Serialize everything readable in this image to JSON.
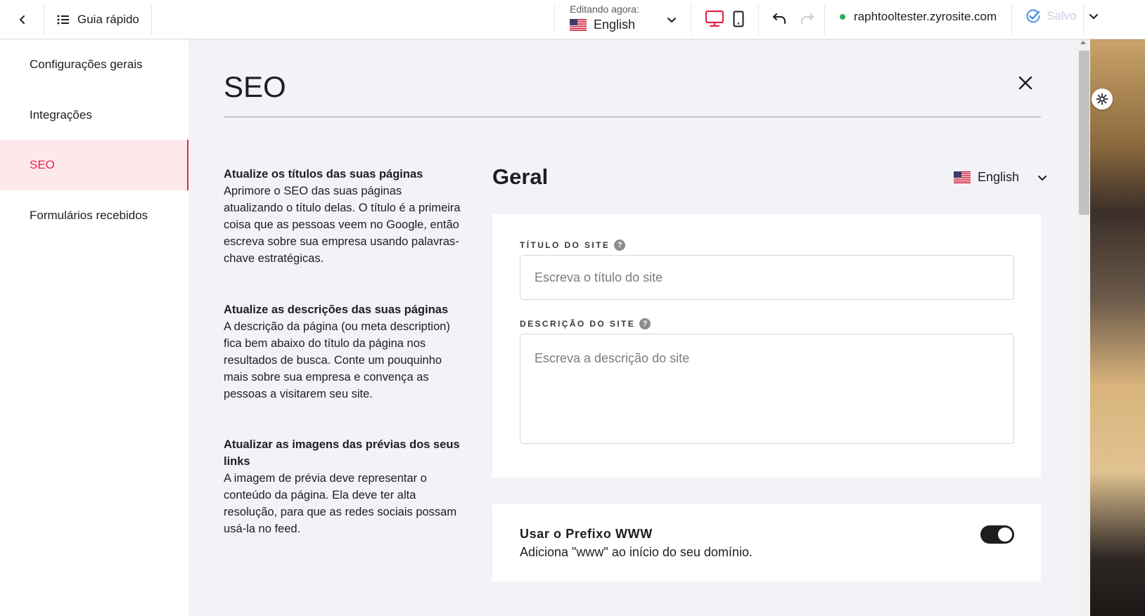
{
  "topbar": {
    "guide_label": "Guia rápido",
    "editing_caption": "Editando agora:",
    "editing_language": "English",
    "site_url": "raphtooltester.zyrosite.com",
    "saved_label": "Salvo"
  },
  "sidebar": {
    "items": [
      {
        "label": "Configurações gerais"
      },
      {
        "label": "Integrações"
      },
      {
        "label": "SEO"
      },
      {
        "label": "Formulários recebidos"
      }
    ],
    "active_index": 2
  },
  "main": {
    "title": "SEO",
    "tips": [
      {
        "title": "Atualize os títulos das suas páginas",
        "body": "Aprimore o SEO das suas páginas atualizando o título delas. O título é a primeira coisa que as pessoas veem no Google, então escreva sobre sua empresa usando palavras-chave estratégicas."
      },
      {
        "title": "Atualize as descrições das suas páginas",
        "body": "A descrição da página (ou meta description) fica bem abaixo do título da página nos resultados de busca. Conte um pouquinho mais sobre sua empresa e convença as pessoas a visitarem seu site."
      },
      {
        "title": "Atualizar as imagens das prévias dos seus links",
        "body": "A imagem de prévia deve representar o conteúdo da página. Ela deve ter alta resolução, para que as redes sociais possam usá-la no feed."
      }
    ],
    "section_title": "Geral",
    "section_language": "English",
    "site_title_label": "Título do site",
    "site_title_placeholder": "Escreva o título do site",
    "site_title_value": "",
    "site_description_label": "Descrição do site",
    "site_description_placeholder": "Escreva a descrição do site",
    "site_description_value": "",
    "www_title": "Usar o Prefixo WWW",
    "www_description": "Adiciona \"www\" ao início do seu domínio.",
    "www_enabled": true
  },
  "colors": {
    "accent": "#e3264c",
    "active_bg": "#fde8ec",
    "panel_bg": "#f2f3f6",
    "status_online": "#2fb05a",
    "saved_check": "#4a90e2"
  },
  "icons": {
    "back": "chevron-left-icon",
    "guide": "list-icon",
    "flag": "us-flag-icon",
    "desktop": "desktop-icon",
    "mobile": "mobile-icon",
    "undo": "undo-icon",
    "redo": "redo-icon",
    "saved": "check-circle-icon",
    "close": "close-icon",
    "help": "question-icon",
    "preview_settings": "gear-icon"
  }
}
